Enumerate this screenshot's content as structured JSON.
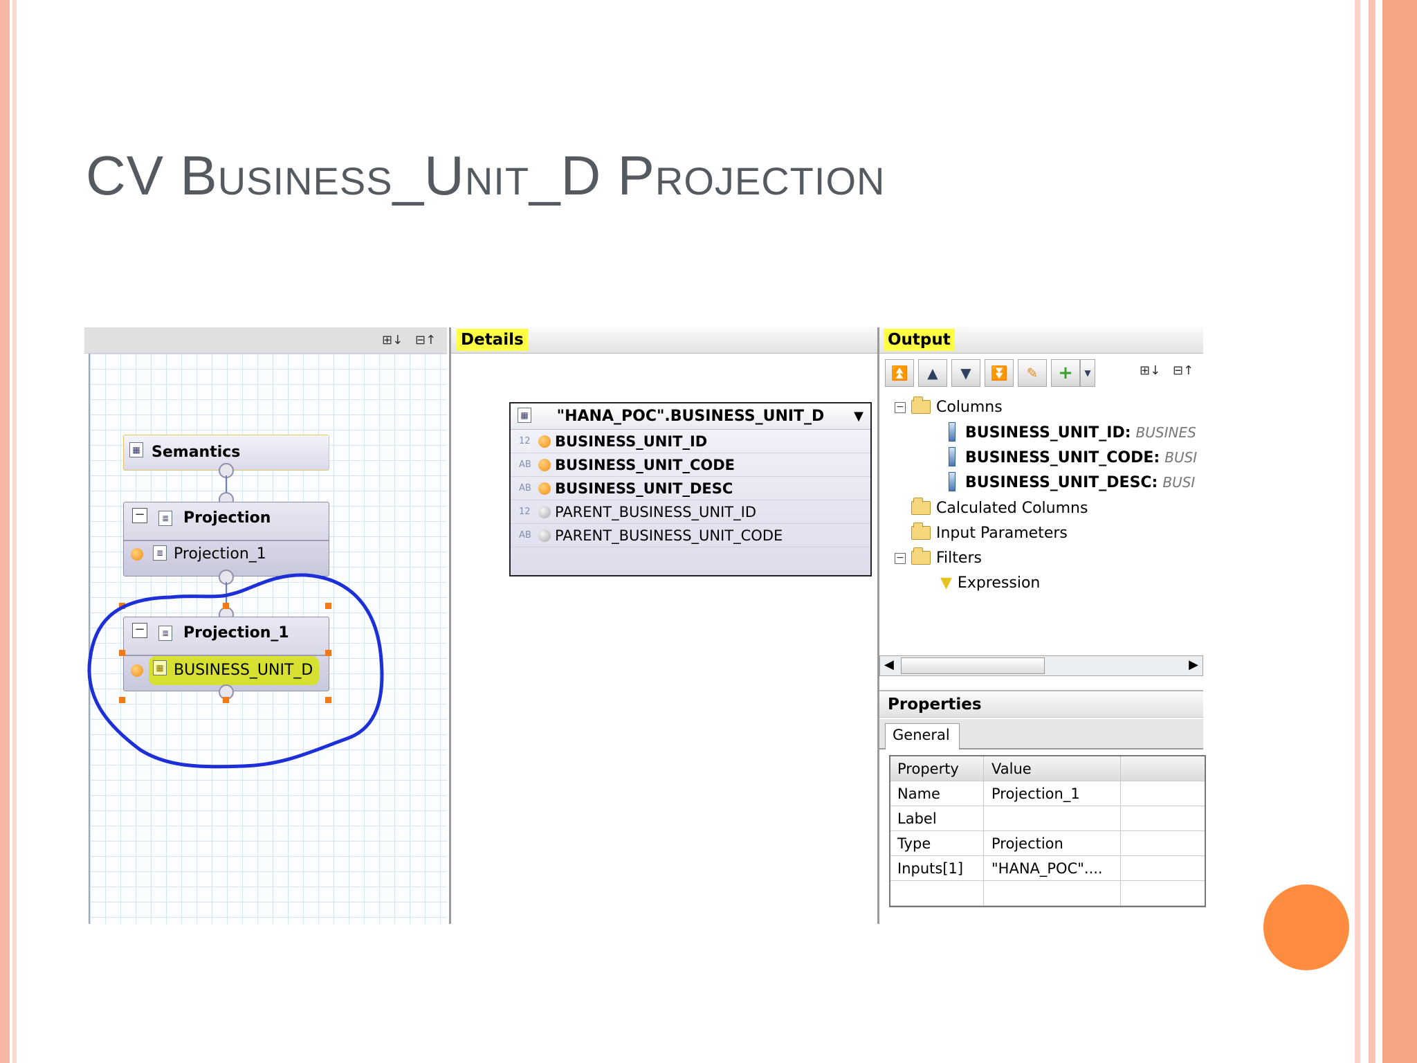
{
  "slide": {
    "title": "CV Business_Unit_D Projection",
    "accent_colors": {
      "left_stripe": "#f9c3b2",
      "right_stripe": "#f6a486",
      "orange_circle": "#fd8c3f",
      "highlight": "#ffff44"
    }
  },
  "editor": {
    "toolbar": {
      "expand_icon": "expand-all-icon",
      "collapse_icon": "collapse-all-icon"
    },
    "nodes": {
      "semantics": {
        "label": "Semantics"
      },
      "projection": {
        "label": "Projection",
        "child": "Projection_1"
      },
      "projection_1": {
        "label": "Projection_1",
        "child": "BUSINESS_UNIT_D"
      }
    }
  },
  "details": {
    "title": "Details",
    "table": {
      "name": "\"HANA_POC\".BUSINESS_UNIT_D",
      "rows": [
        {
          "type": "12",
          "name": "BUSINESS_UNIT_ID",
          "selected": true
        },
        {
          "type": "AB",
          "name": "BUSINESS_UNIT_CODE",
          "selected": true
        },
        {
          "type": "AB",
          "name": "BUSINESS_UNIT_DESC",
          "selected": true
        },
        {
          "type": "12",
          "name": "PARENT_BUSINESS_UNIT_ID",
          "selected": false
        },
        {
          "type": "AB",
          "name": "PARENT_BUSINESS_UNIT_CODE",
          "selected": false
        }
      ]
    }
  },
  "output": {
    "title": "Output",
    "tree": {
      "columns_label": "Columns",
      "columns": [
        {
          "name": "BUSINESS_UNIT_ID:",
          "type": "BUSINES"
        },
        {
          "name": "BUSINESS_UNIT_CODE:",
          "type": "BUSI"
        },
        {
          "name": "BUSINESS_UNIT_DESC:",
          "type": "BUSI"
        }
      ],
      "calculated_columns": "Calculated Columns",
      "input_parameters": "Input Parameters",
      "filters": "Filters",
      "expression": "Expression"
    }
  },
  "properties": {
    "title": "Properties",
    "tab": "General",
    "headers": {
      "property": "Property",
      "value": "Value"
    },
    "rows": [
      {
        "property": "Name",
        "value": "Projection_1"
      },
      {
        "property": "Label",
        "value": ""
      },
      {
        "property": "Type",
        "value": "Projection"
      },
      {
        "property": "Inputs[1]",
        "value": "\"HANA_POC\"...."
      }
    ]
  }
}
